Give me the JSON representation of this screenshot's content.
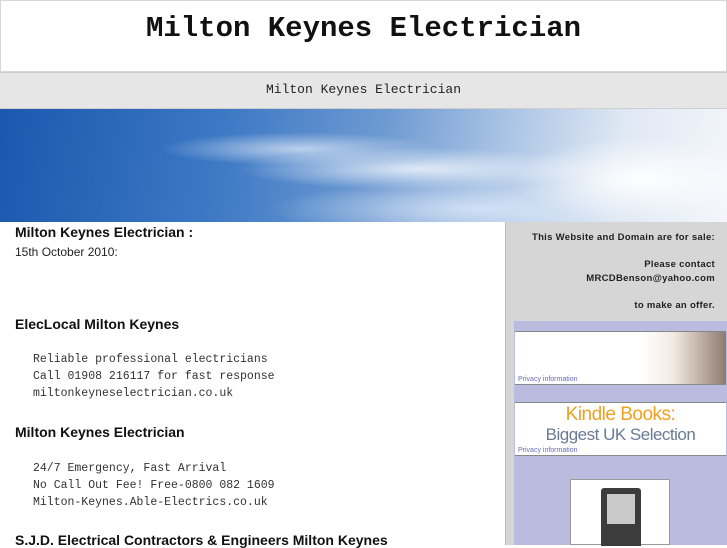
{
  "header": {
    "title": "Milton Keynes Electrician"
  },
  "subtitle": "Milton Keynes Electrician",
  "main": {
    "intro_heading": "Milton Keynes Electrician :",
    "date": "15th October 2010:",
    "sections": [
      {
        "heading": "ElecLocal Milton Keynes",
        "lines": [
          "Reliable professional electricians",
          "Call 01908 216117 for fast response",
          "miltonkeyneselectrician.co.uk"
        ]
      },
      {
        "heading": "Milton Keynes Electrician",
        "lines": [
          "24/7 Emergency, Fast Arrival",
          "No Call Out Fee! Free-0800 082 1609",
          "Milton-Keynes.Able-Electrics.co.uk"
        ]
      },
      {
        "heading": "S.J.D. Electrical Contractors & Engineers Milton Keynes",
        "lines": []
      }
    ]
  },
  "sidebar": {
    "sale_notice": "This Website and Domain are for sale:",
    "contact_line": "Please contact",
    "email": "MRCDBenson@yahoo.com",
    "offer_line": "to make an offer.",
    "ads": [
      {
        "privacy": "Privacy information"
      },
      {
        "title": "Kindle Books:",
        "subtitle": "Biggest UK Selection",
        "privacy": "Privacy information"
      }
    ]
  },
  "colors": {
    "ad_panel": "#b9bbdf",
    "kindle_orange": "#f0a020",
    "sidebar_bg": "#d6d6d6"
  }
}
